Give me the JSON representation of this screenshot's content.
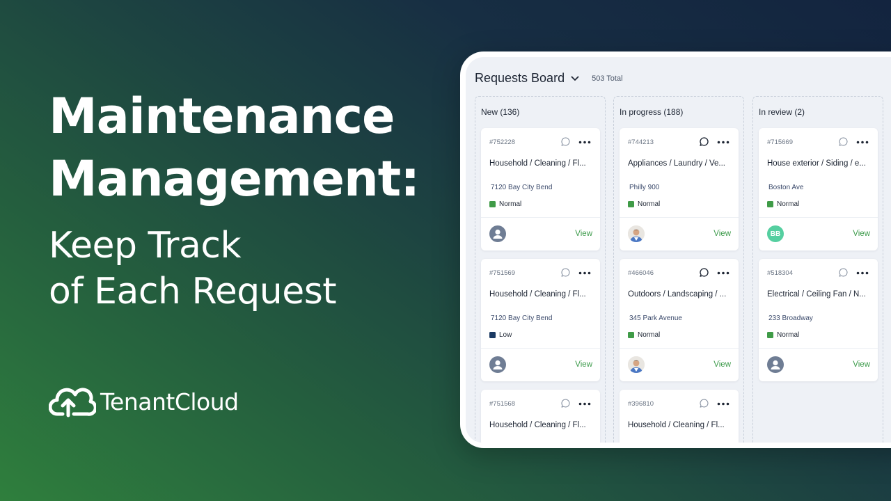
{
  "hero": {
    "title_line1": "Maintenance",
    "title_line2": "Management:",
    "subtitle_line1": "Keep Track",
    "subtitle_line2": "of Each Request"
  },
  "brand": {
    "name": "TenantCloud"
  },
  "board": {
    "title": "Requests Board",
    "total": "503 Total",
    "view_label": "View",
    "columns": [
      {
        "title": "New (136)",
        "cards": [
          {
            "id": "#752228",
            "title": "Household / Cleaning / Fl...",
            "address": "7120 Bay City Bend",
            "priority": "Normal",
            "priority_color": "#3f9b47",
            "avatar": "default"
          },
          {
            "id": "#751569",
            "title": "Household / Cleaning / Fl...",
            "address": "7120 Bay City Bend",
            "priority": "Low",
            "priority_color": "#1b3a63",
            "avatar": "default"
          },
          {
            "id": "#751568",
            "title": "Household / Cleaning / Fl..."
          }
        ]
      },
      {
        "title": "In progress (188)",
        "cards": [
          {
            "id": "#744213",
            "title": "Appliances / Laundry / Ve...",
            "address": "Philly 900",
            "priority": "Normal",
            "priority_color": "#3f9b47",
            "avatar": "photo"
          },
          {
            "id": "#466046",
            "title": "Outdoors / Landscaping / ...",
            "address": "345 Park Avenue",
            "priority": "Normal",
            "priority_color": "#3f9b47",
            "avatar": "photo"
          },
          {
            "id": "#396810",
            "title": "Household / Cleaning / Fl..."
          }
        ]
      },
      {
        "title": "In review (2)",
        "cards": [
          {
            "id": "#715669",
            "title": "House exterior / Siding / e...",
            "address": "Boston Ave",
            "priority": "Normal",
            "priority_color": "#3f9b47",
            "avatar": "initials",
            "initials": "BB"
          },
          {
            "id": "#518304",
            "title": "Electrical / Ceiling Fan / N...",
            "address": "233 Broadway",
            "priority": "Normal",
            "priority_color": "#3f9b47",
            "avatar": "default"
          }
        ]
      }
    ]
  },
  "colors": {
    "accent_green": "#3d9b4b",
    "priority_normal": "#3f9b47",
    "priority_low": "#1b3a63",
    "avatar_initials_bg": "#55cfa0"
  }
}
